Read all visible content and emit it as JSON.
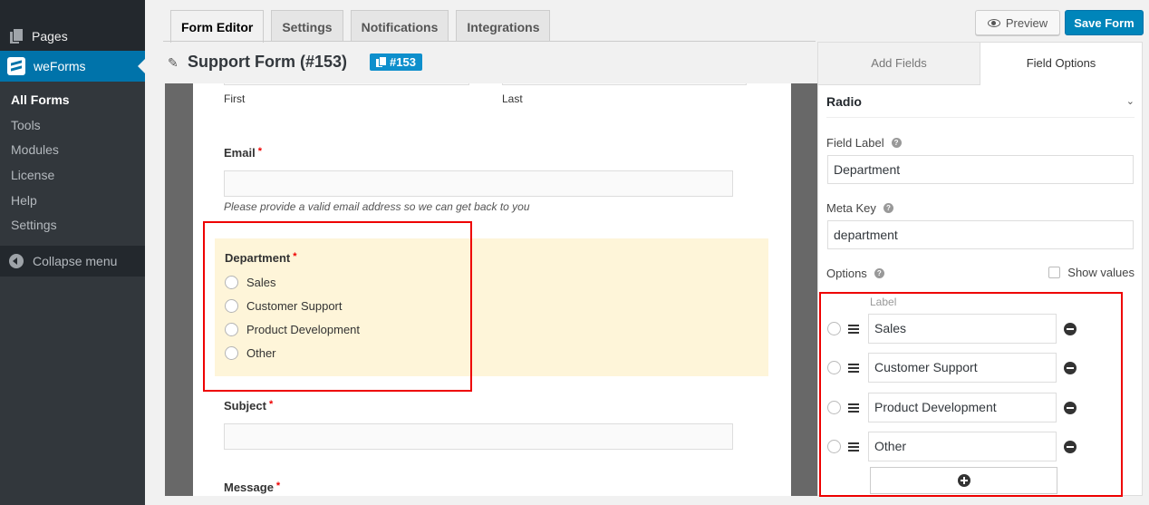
{
  "sidebar": {
    "pages_label": "Pages",
    "plugin_label": "weForms",
    "submenu": [
      "All Forms",
      "Tools",
      "Modules",
      "License",
      "Help",
      "Settings"
    ],
    "active_submenu": "All Forms",
    "collapse_label": "Collapse menu"
  },
  "tabs": [
    {
      "label": "Form Editor",
      "active": true
    },
    {
      "label": "Settings",
      "active": false
    },
    {
      "label": "Notifications",
      "active": false
    },
    {
      "label": "Integrations",
      "active": false
    }
  ],
  "header": {
    "form_title": "Support Form (#153)",
    "shortcode_badge": "#153",
    "preview_label": "Preview",
    "save_label": "Save Form"
  },
  "form_preview": {
    "name_sublabels": {
      "first": "First",
      "last": "Last"
    },
    "email": {
      "label": "Email",
      "required_mark": "*",
      "hint": "Please provide a valid email address so we can get back to you"
    },
    "department": {
      "label": "Department",
      "required_mark": "*",
      "options": [
        "Sales",
        "Customer Support",
        "Product Development",
        "Other"
      ]
    },
    "subject": {
      "label": "Subject",
      "required_mark": "*"
    },
    "message": {
      "label": "Message",
      "required_mark": "*"
    }
  },
  "right_panel": {
    "tabs": [
      {
        "label": "Add Fields",
        "active": false
      },
      {
        "label": "Field Options",
        "active": true
      }
    ],
    "field_type": "Radio",
    "field_label_title": "Field Label",
    "field_label_value": "Department",
    "meta_key_title": "Meta Key",
    "meta_key_value": "department",
    "options_title": "Options",
    "show_values_label": "Show values",
    "show_values_checked": false,
    "options_column_header": "Label",
    "options": [
      "Sales",
      "Customer Support",
      "Product Development",
      "Other"
    ]
  },
  "colors": {
    "accent": "#0085ba",
    "highlight": "#fef5d9",
    "annotation": "#ee0000"
  }
}
